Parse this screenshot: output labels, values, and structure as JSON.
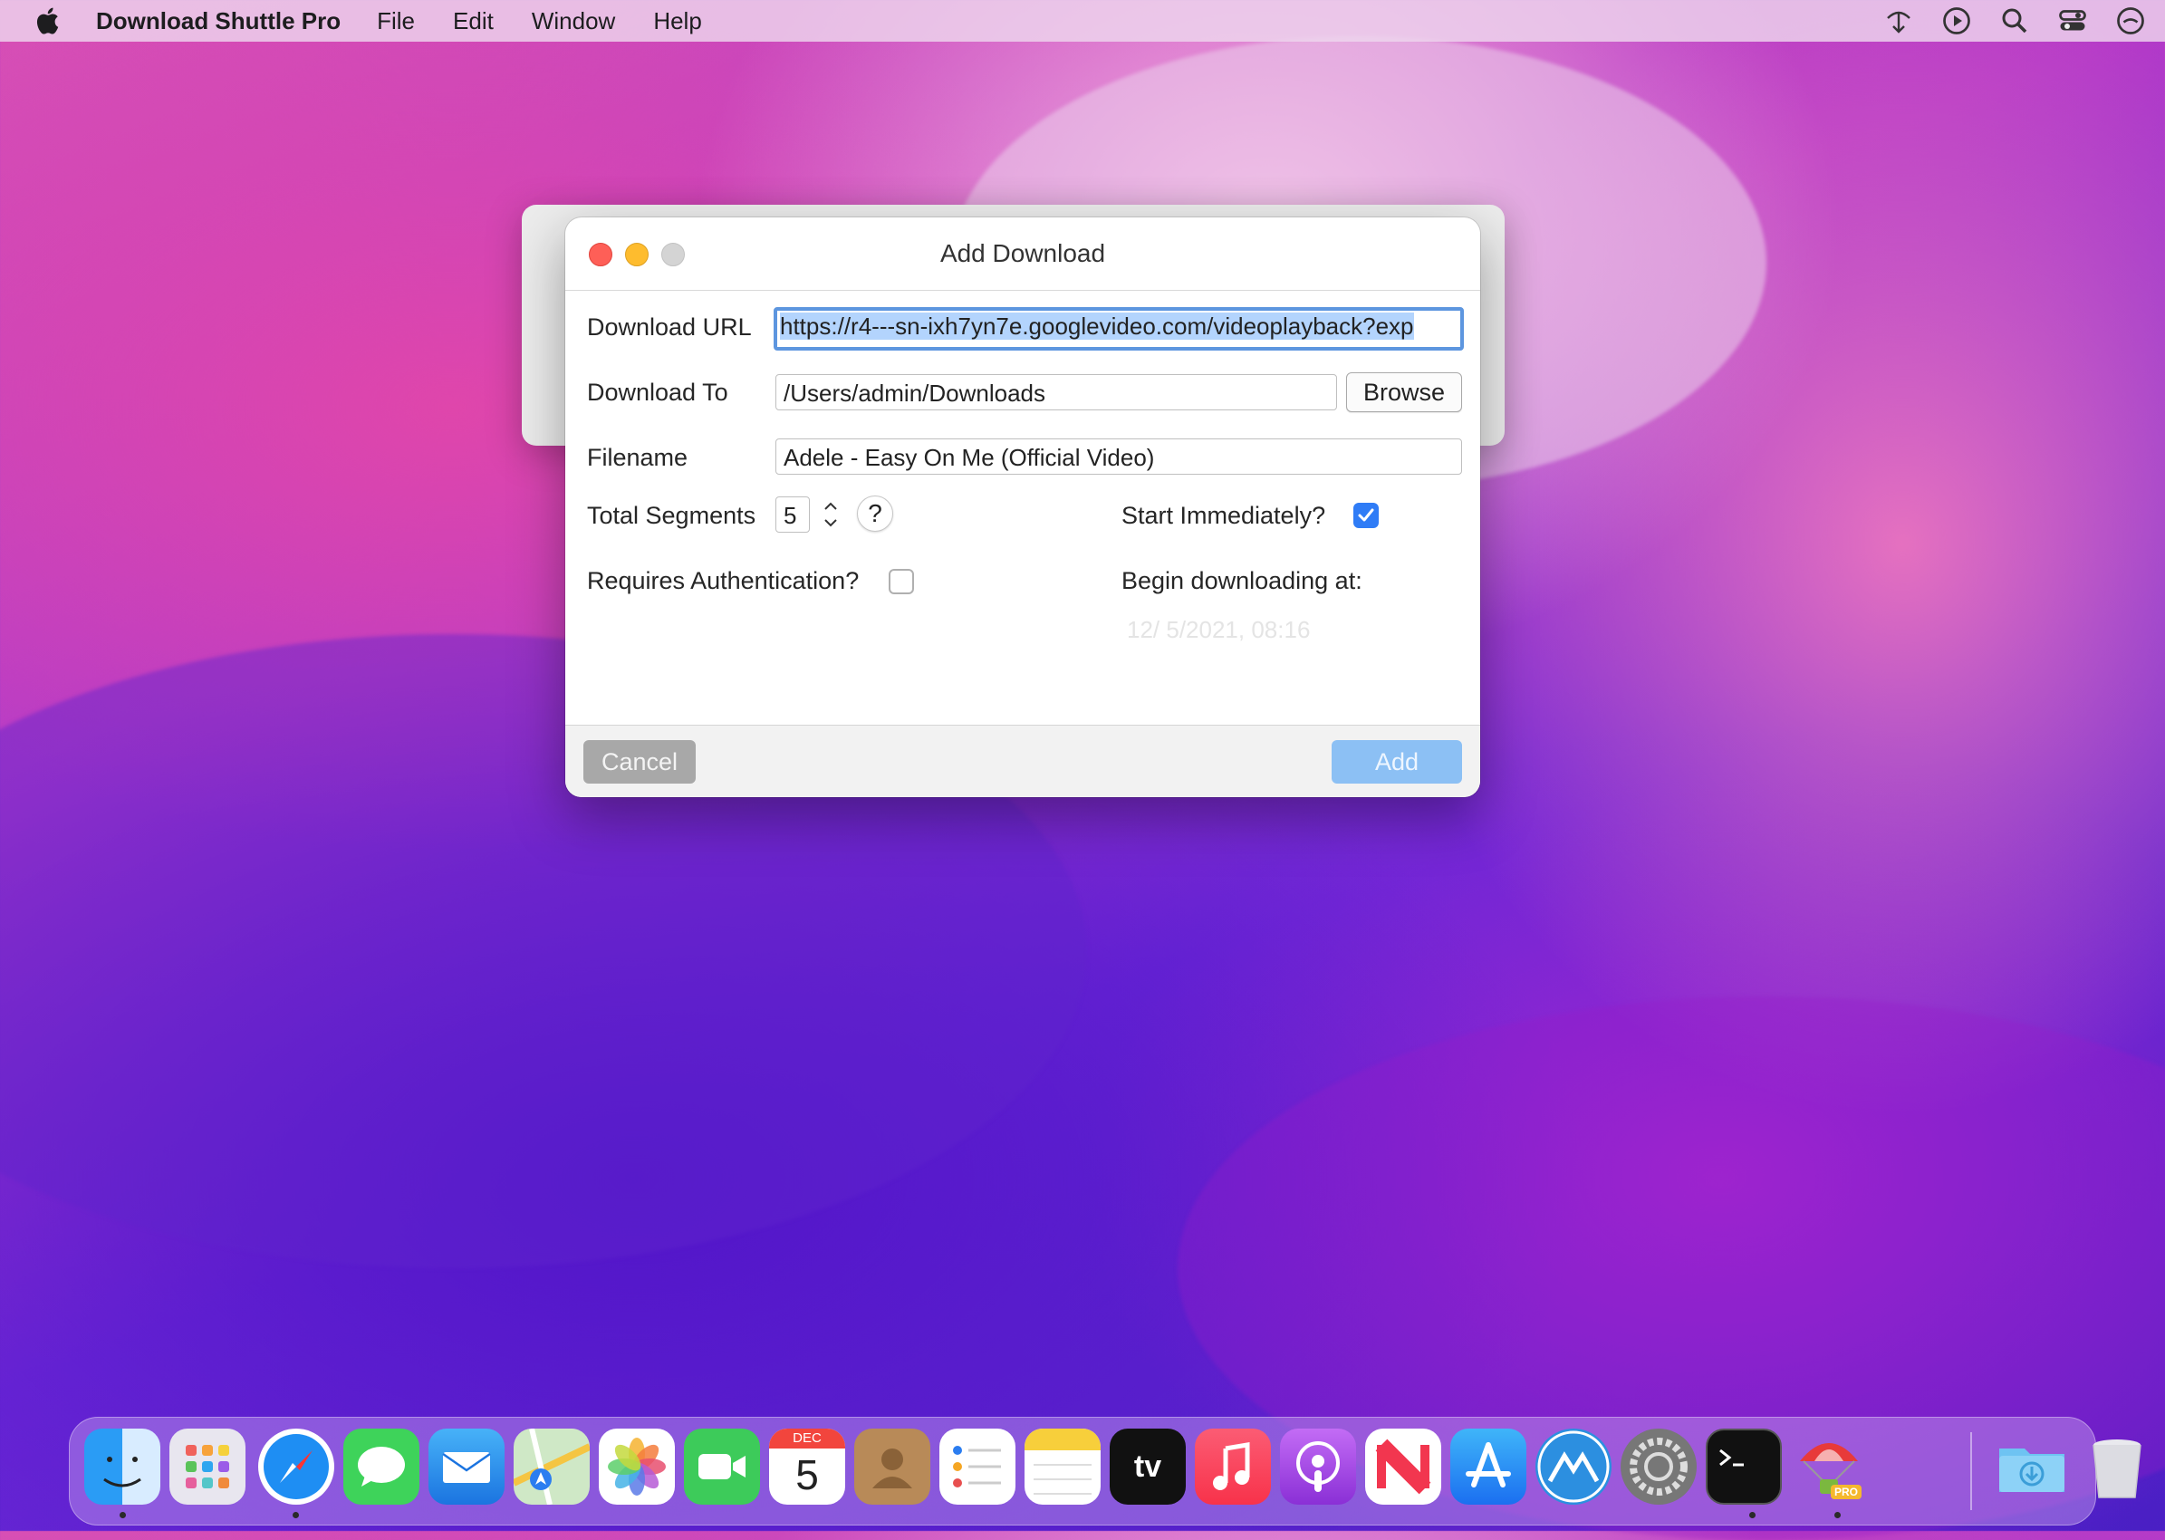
{
  "menubar": {
    "app_name": "Download Shuttle Pro",
    "menus": [
      "File",
      "Edit",
      "Window",
      "Help"
    ]
  },
  "dialog": {
    "title": "Add Download",
    "download_url_label": "Download URL",
    "download_url_value": "https://r4---sn-ixh7yn7e.googlevideo.com/videoplayback?exp",
    "download_to_label": "Download To",
    "download_to_value": "/Users/admin/Downloads",
    "browse_label": "Browse",
    "filename_label": "Filename",
    "filename_value": "Adele - Easy On Me (Official Video)",
    "total_segments_label": "Total Segments",
    "total_segments_value": "5",
    "help_label": "?",
    "start_immediately_label": "Start Immediately?",
    "start_immediately_checked": true,
    "requires_auth_label": "Requires Authentication?",
    "requires_auth_checked": false,
    "begin_at_label": "Begin downloading at:",
    "begin_at_value": "12/ 5/2021, 08:16",
    "cancel_label": "Cancel",
    "add_label": "Add"
  },
  "dock": {
    "apps": [
      "finder-icon",
      "launchpad-icon",
      "safari-icon",
      "messages-icon",
      "mail-icon",
      "maps-icon",
      "photos-icon",
      "facetime-icon",
      "calendar-icon",
      "contacts-icon",
      "reminders-icon",
      "notes-icon",
      "apple-tv-icon",
      "music-icon",
      "podcasts-icon",
      "news-icon",
      "app-store-icon",
      "altitude-icon",
      "system-preferences-icon",
      "terminal-icon",
      "download-shuttle-pro-icon",
      "downloads-folder-icon",
      "trash-icon"
    ],
    "calendar_month": "DEC",
    "calendar_day": "5",
    "tv_label": "tv",
    "pro_badge": "PRO"
  }
}
